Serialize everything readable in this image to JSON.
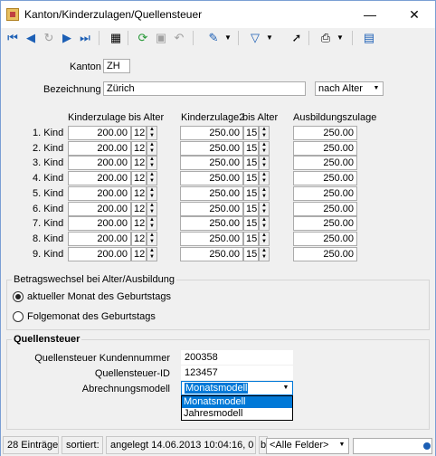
{
  "window": {
    "title": "Kanton/Kinderzulagen/Quellensteuer",
    "close_glyph": "✕",
    "min_glyph": "—"
  },
  "toolbar": {
    "icons": [
      "first-record-icon",
      "prev-record-icon",
      "refresh-disabled-icon",
      "next-record-icon",
      "last-record-icon",
      "table-view-icon",
      "reload-icon",
      "save-icon",
      "undo-icon",
      "pin-icon",
      "filter-icon",
      "cursor-select-icon",
      "print-icon",
      "export-icon"
    ]
  },
  "form": {
    "kanton_label": "Kanton",
    "kanton_value": "ZH",
    "bezeichnung_label": "Bezeichnung",
    "bezeichnung_value": "Zürich",
    "sort_option": "nach Alter"
  },
  "grid": {
    "headers": {
      "kinderzulage": "Kinderzulage",
      "bis_alter_1": "bis Alter",
      "kinderzulage2": "Kinderzulage2",
      "bis_alter_2": "bis Alter",
      "ausbildungszulage": "Ausbildungszulage"
    },
    "rows": [
      {
        "label": "1. Kind",
        "kz": "200.00",
        "age1": "12",
        "kz2": "250.00",
        "age2": "15",
        "az": "250.00"
      },
      {
        "label": "2. Kind",
        "kz": "200.00",
        "age1": "12",
        "kz2": "250.00",
        "age2": "15",
        "az": "250.00"
      },
      {
        "label": "3. Kind",
        "kz": "200.00",
        "age1": "12",
        "kz2": "250.00",
        "age2": "15",
        "az": "250.00"
      },
      {
        "label": "4. Kind",
        "kz": "200.00",
        "age1": "12",
        "kz2": "250.00",
        "age2": "15",
        "az": "250.00"
      },
      {
        "label": "5. Kind",
        "kz": "200.00",
        "age1": "12",
        "kz2": "250.00",
        "age2": "15",
        "az": "250.00"
      },
      {
        "label": "6. Kind",
        "kz": "200.00",
        "age1": "12",
        "kz2": "250.00",
        "age2": "15",
        "az": "250.00"
      },
      {
        "label": "7. Kind",
        "kz": "200.00",
        "age1": "12",
        "kz2": "250.00",
        "age2": "15",
        "az": "250.00"
      },
      {
        "label": "8. Kind",
        "kz": "200.00",
        "age1": "12",
        "kz2": "250.00",
        "age2": "15",
        "az": "250.00"
      },
      {
        "label": "9. Kind",
        "kz": "200.00",
        "age1": "12",
        "kz2": "250.00",
        "age2": "15",
        "az": "250.00"
      }
    ]
  },
  "betragswechsel": {
    "title": "Betragswechsel bei Alter/Ausbildung",
    "option1": "aktueller Monat des Geburtstags",
    "option2": "Folgemonat des Geburtstags",
    "selected": 1
  },
  "quellensteuer": {
    "title": "Quellensteuer",
    "kundennummer_label": "Quellensteuer Kundennummer",
    "kundennummer_value": "200358",
    "id_label": "Quellensteuer-ID",
    "id_value": "123457",
    "modell_label": "Abrechnungsmodell",
    "modell_value": "Monatsmodell",
    "modell_options": [
      "Monatsmodell",
      "Jahresmodell"
    ]
  },
  "status": {
    "count": "28 Einträge",
    "sorted": "sortiert:",
    "created": "angelegt 14.06.2013 10:04:16,  0",
    "b_prefix": "b",
    "fields": "<Alle Felder>"
  }
}
